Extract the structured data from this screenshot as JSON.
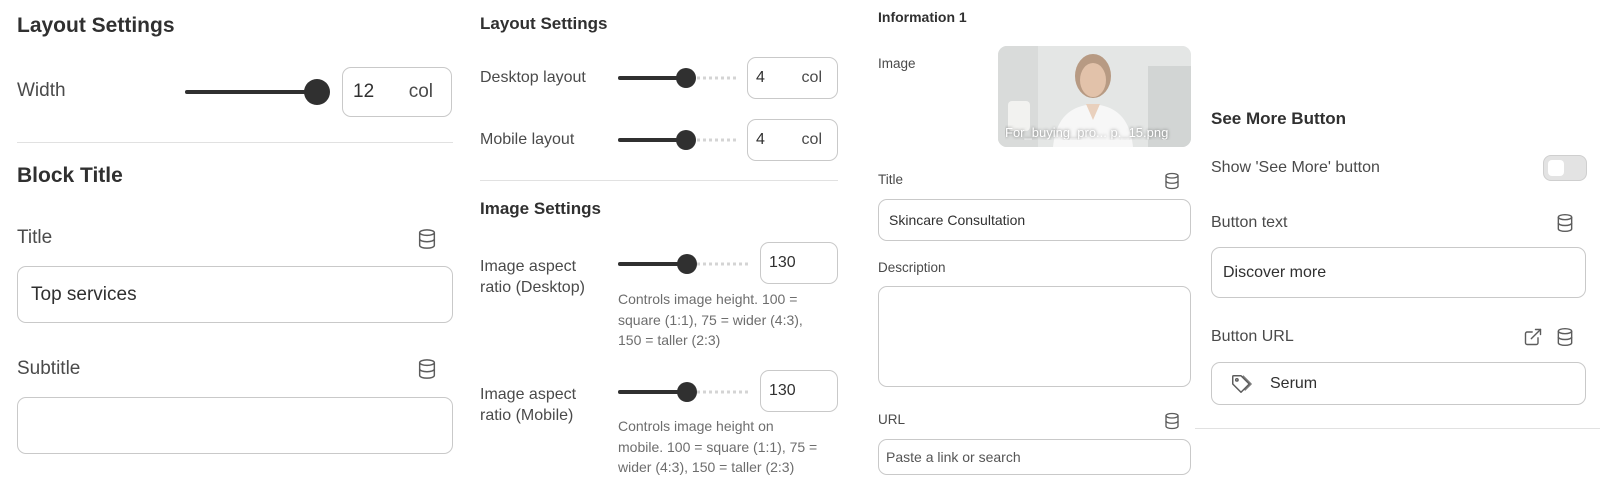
{
  "layout": {
    "title": "Layout Settings",
    "width_label": "Width",
    "width_value": "12",
    "width_unit": "col",
    "width_level": 1.0
  },
  "block_title": {
    "heading": "Block Title",
    "title_label": "Title",
    "title_value": "Top services",
    "subtitle_label": "Subtitle",
    "subtitle_value": ""
  },
  "layout2": {
    "title": "Layout Settings",
    "desktop_label": "Desktop layout",
    "desktop_value": "4",
    "desktop_unit": "col",
    "desktop_level": 0.58,
    "mobile_label": "Mobile layout",
    "mobile_value": "4",
    "mobile_unit": "col",
    "mobile_level": 0.58
  },
  "image_settings": {
    "title": "Image Settings",
    "desktop_label_1": "Image aspect",
    "desktop_label_2": "ratio (Desktop)",
    "desktop_value": "130",
    "desktop_level": 0.53,
    "desktop_help_1": "Controls image height. 100 =",
    "desktop_help_2": "square (1:1), 75 = wider (4:3),",
    "desktop_help_3": "150 = taller (2:3)",
    "mobile_label_1": "Image aspect",
    "mobile_label_2": "ratio (Mobile)",
    "mobile_value": "130",
    "mobile_level": 0.53,
    "mobile_help_1": "Controls image height on",
    "mobile_help_2": "mobile. 100 = square (1:1), 75 =",
    "mobile_help_3": "wider (4:3), 150 = taller (2:3)"
  },
  "information": {
    "title": "Information 1",
    "image_label": "Image",
    "image_caption": "For_buying_pro... p._15.png",
    "title_label": "Title",
    "title_value": "Skincare Consultation",
    "description_label": "Description",
    "description_value": "",
    "url_label": "URL",
    "url_placeholder": "Paste a link or search"
  },
  "see_more": {
    "title": "See More Button",
    "show_label": "Show 'See More' button",
    "show_enabled": false,
    "button_text_label": "Button text",
    "button_text_value": "Discover more",
    "button_url_label": "Button URL",
    "button_url_value": "Serum"
  },
  "icons": {
    "database": "database-icon",
    "external_link": "external-link-icon",
    "tag": "tag-icon"
  }
}
